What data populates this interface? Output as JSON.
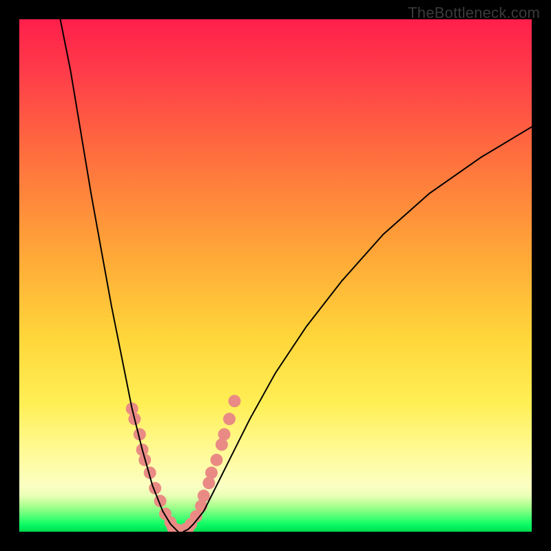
{
  "watermark": "TheBottleneck.com",
  "chart_data": {
    "type": "line",
    "title": "",
    "xlabel": "",
    "ylabel": "",
    "xlim": [
      0,
      100
    ],
    "ylim": [
      0,
      100
    ],
    "grid": false,
    "gradient_stops": [
      {
        "pct": 0,
        "color": "#ff1f4b"
      },
      {
        "pct": 10,
        "color": "#ff3b4a"
      },
      {
        "pct": 25,
        "color": "#ff6a3f"
      },
      {
        "pct": 45,
        "color": "#ffa538"
      },
      {
        "pct": 62,
        "color": "#ffd63a"
      },
      {
        "pct": 75,
        "color": "#ffef55"
      },
      {
        "pct": 85,
        "color": "#fffb9a"
      },
      {
        "pct": 91,
        "color": "#fbffc2"
      },
      {
        "pct": 93,
        "color": "#e9ffb6"
      },
      {
        "pct": 95,
        "color": "#a8ff8e"
      },
      {
        "pct": 97,
        "color": "#55ff78"
      },
      {
        "pct": 98.2,
        "color": "#1aff67"
      },
      {
        "pct": 99.2,
        "color": "#00f05d"
      },
      {
        "pct": 100,
        "color": "#00d94f"
      }
    ],
    "series": [
      {
        "name": "left-curve",
        "stroke": "#000000",
        "x": [
          8,
          10,
          12,
          14,
          16,
          18,
          20,
          22,
          24,
          26,
          28,
          29.5,
          30.5,
          31
        ],
        "y": [
          100,
          90,
          78,
          66,
          55,
          44,
          34,
          24,
          16,
          9,
          4,
          1.5,
          0.5,
          0
        ]
      },
      {
        "name": "right-curve",
        "stroke": "#000000",
        "x": [
          32,
          33,
          34,
          36,
          38,
          41,
          45,
          50,
          56,
          63,
          71,
          80,
          90,
          100
        ],
        "y": [
          0,
          0.5,
          1.5,
          4,
          8,
          14,
          22,
          31,
          40,
          49,
          58,
          66,
          73,
          79
        ]
      }
    ],
    "dot_clusters": [
      {
        "name": "left-cluster",
        "color": "#e98b84",
        "points": [
          {
            "x": 22.0,
            "y": 24.0
          },
          {
            "x": 22.5,
            "y": 22.0
          },
          {
            "x": 23.5,
            "y": 19.0
          },
          {
            "x": 24.0,
            "y": 16.0
          },
          {
            "x": 24.5,
            "y": 14.0
          },
          {
            "x": 25.5,
            "y": 11.5
          },
          {
            "x": 26.5,
            "y": 8.5
          },
          {
            "x": 27.5,
            "y": 6.0
          },
          {
            "x": 28.5,
            "y": 3.5
          },
          {
            "x": 29.5,
            "y": 1.8
          }
        ]
      },
      {
        "name": "bottom-cluster",
        "color": "#e98b84",
        "points": [
          {
            "x": 30.0,
            "y": 0.8
          },
          {
            "x": 30.8,
            "y": 0.4
          },
          {
            "x": 31.5,
            "y": 0.2
          },
          {
            "x": 32.2,
            "y": 0.4
          },
          {
            "x": 33.0,
            "y": 0.8
          }
        ]
      },
      {
        "name": "right-cluster",
        "color": "#e98b84",
        "points": [
          {
            "x": 33.5,
            "y": 1.5
          },
          {
            "x": 34.5,
            "y": 3.0
          },
          {
            "x": 35.5,
            "y": 5.0
          },
          {
            "x": 36.0,
            "y": 7.0
          },
          {
            "x": 37.0,
            "y": 9.5
          },
          {
            "x": 37.5,
            "y": 11.5
          },
          {
            "x": 38.5,
            "y": 14.0
          },
          {
            "x": 39.5,
            "y": 17.0
          },
          {
            "x": 40.0,
            "y": 19.0
          },
          {
            "x": 41.0,
            "y": 22.0
          },
          {
            "x": 42.0,
            "y": 25.5
          }
        ]
      }
    ]
  }
}
